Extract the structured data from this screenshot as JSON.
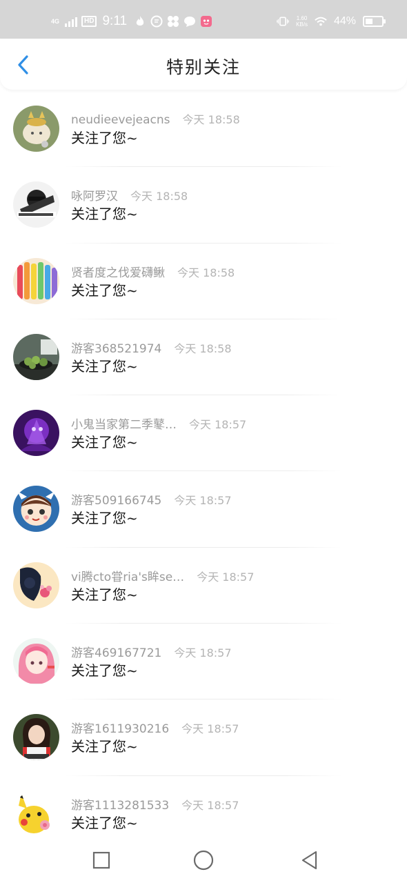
{
  "status_bar": {
    "network": "4G",
    "hd": "HD",
    "time": "9:11",
    "speed_top": "1.60",
    "speed_bottom": "KB/s",
    "battery_pct": "44%",
    "battery_level": 0.44
  },
  "nav": {
    "title": "特别关注",
    "back_icon": "chevron-left-icon",
    "accent": "#2f8fe6"
  },
  "rows": [
    {
      "name": "neudieevejeacns",
      "time": "今天  18:58",
      "action": "关注了您~"
    },
    {
      "name": "咏阿罗汉",
      "time": "今天  18:58",
      "action": "关注了您~"
    },
    {
      "name": "贤者度之伐爱礴鳅",
      "time": "今天  18:58",
      "action": "关注了您~"
    },
    {
      "name": "游客368521974",
      "time": "今天  18:58",
      "action": "关注了您~"
    },
    {
      "name": "小鬼当家第二季鼕…",
      "time": "今天  18:57",
      "action": "关注了您~"
    },
    {
      "name": "游客509166745",
      "time": "今天  18:57",
      "action": "关注了您~"
    },
    {
      "name": "vi腾cto甞ria's眸se…",
      "time": "今天  18:57",
      "action": "关注了您~"
    },
    {
      "name": "游客469167721",
      "time": "今天  18:57",
      "action": "关注了您~"
    },
    {
      "name": "游客1611930216",
      "time": "今天  18:57",
      "action": "关注了您~"
    },
    {
      "name": "游客1113281533",
      "time": "今天  18:57",
      "action": "关注了您~"
    }
  ],
  "system_nav": {
    "recents_icon": "square-icon",
    "home_icon": "circle-icon",
    "back_icon": "triangle-back-icon"
  }
}
